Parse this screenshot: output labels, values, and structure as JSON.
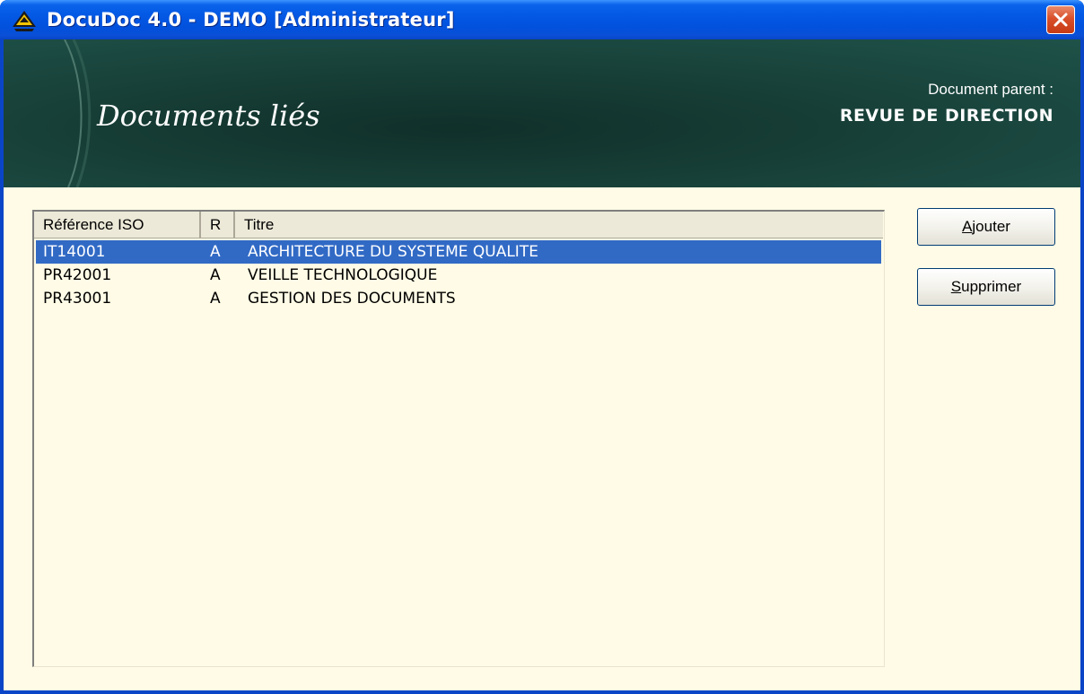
{
  "window": {
    "title": "DocuDoc 4.0 - DEMO [Administrateur]"
  },
  "banner": {
    "title": "Documents liés",
    "parent_label": "Document parent :",
    "parent_value": "REVUE DE DIRECTION"
  },
  "list": {
    "columns": {
      "ref": "Référence ISO",
      "r": "R",
      "titre": "Titre"
    },
    "rows": [
      {
        "ref": "IT14001",
        "r": "A",
        "titre": "ARCHITECTURE DU SYSTEME QUALITE",
        "selected": true
      },
      {
        "ref": "PR42001",
        "r": "A",
        "titre": "VEILLE TECHNOLOGIQUE",
        "selected": false
      },
      {
        "ref": "PR43001",
        "r": "A",
        "titre": "GESTION DES DOCUMENTS",
        "selected": false
      }
    ]
  },
  "buttons": {
    "ajouter": {
      "accel": "A",
      "rest": "jouter"
    },
    "supprimer": {
      "accel": "S",
      "rest": "upprimer"
    }
  },
  "colors": {
    "titlebar": "#0358e4",
    "banner": "#1b4a42",
    "client_bg": "#fffbe6",
    "selection": "#316ac5",
    "close_button": "#d9502a"
  },
  "icons": {
    "app": "docudoc-logo-icon",
    "close": "close-icon"
  }
}
